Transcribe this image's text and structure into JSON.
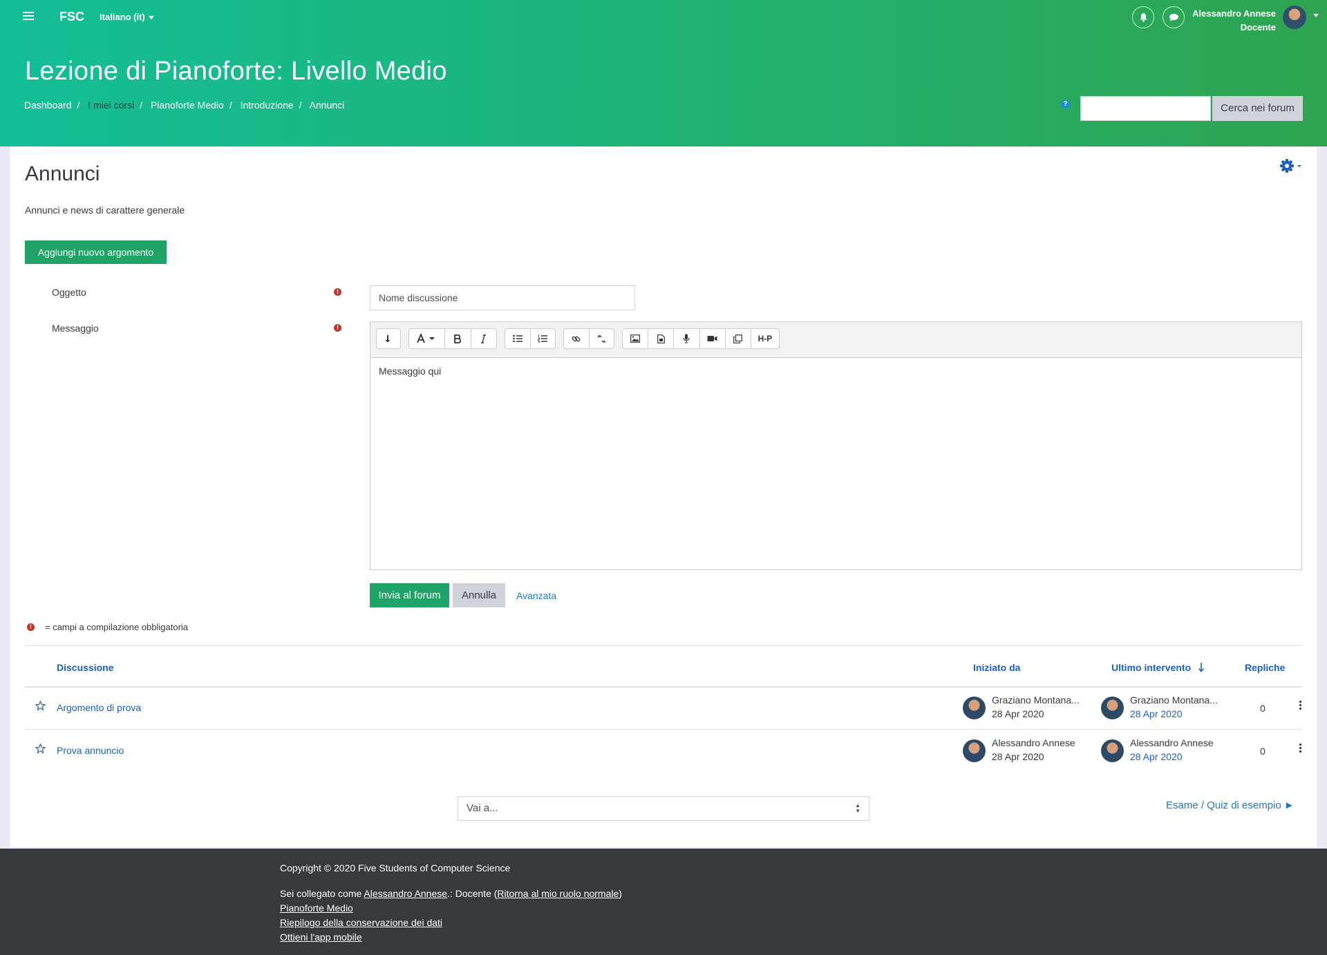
{
  "header": {
    "brand": "FSC",
    "language": "Italiano (it)",
    "user_name": "Alessandro Annese",
    "user_role": "Docente",
    "course_title": "Lezione di Pianoforte: Livello Medio",
    "breadcrumb": [
      "Dashboard",
      "I miei corsi",
      "Pianoforte Medio",
      "Introduzione",
      "Annunci"
    ],
    "search_button": "Cerca nei forum",
    "help_glyph": "?"
  },
  "forum": {
    "title": "Annunci",
    "description": "Annunci e news di carattere generale",
    "add_topic_button": "Aggiungi nuovo argomento"
  },
  "form": {
    "subject_label": "Oggetto",
    "subject_value": "Nome discussione",
    "message_label": "Messaggio",
    "message_value": "Messaggio qui",
    "submit_button": "Invia al forum",
    "cancel_button": "Annulla",
    "advanced_link": "Avanzata",
    "required_note": "= campi a compilazione obbligatoria",
    "required_glyph": "!",
    "toolbar_hp": "H-P"
  },
  "discussions": {
    "columns": {
      "discussion": "Discussione",
      "started_by": "Iniziato da",
      "last_post": "Ultimo intervento",
      "replies": "Repliche"
    },
    "rows": [
      {
        "title": "Argomento di prova",
        "started_by": "Graziano Montana...",
        "started_date": "28 Apr 2020",
        "last_by": "Graziano Montana...",
        "last_date": "28 Apr 2020",
        "replies": "0"
      },
      {
        "title": "Prova annuncio",
        "started_by": "Alessandro Annese",
        "started_date": "28 Apr 2020",
        "last_by": "Alessandro Annese",
        "last_date": "28 Apr 2020",
        "replies": "0"
      }
    ]
  },
  "navigation": {
    "jump_placeholder": "Vai a...",
    "next_activity": "Esame / Quiz di esempio ►"
  },
  "footer": {
    "copyright": "Copyright © 2020 Five Students of Computer Science",
    "logged_prefix": "Sei collegato come ",
    "logged_user": "Alessandro Annese",
    "logged_middle": ".: Docente (",
    "return_role": "Ritorna al mio ruolo normale",
    "logged_suffix": ")",
    "links": [
      "Pianoforte Medio",
      "Riepilogo della conservazione dei dati",
      "Ottieni l'app mobile"
    ]
  },
  "colors": {
    "header_gradient_start": "#14be97",
    "header_gradient_end": "#2ea44f",
    "primary_button": "#1fa366",
    "link": "#1d60c2",
    "required": "#ca3120",
    "footer": "#373a3c"
  }
}
